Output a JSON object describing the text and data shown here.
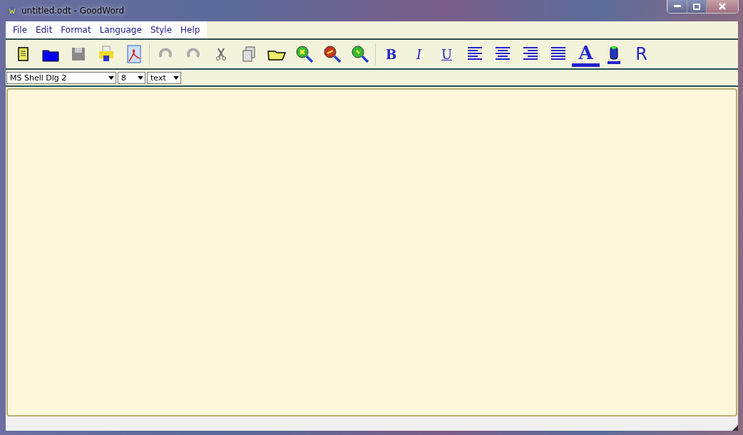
{
  "window": {
    "title": "untitled.odt - GoodWord"
  },
  "menu": [
    "File",
    "Edit",
    "Format",
    "Language",
    "Style",
    "Help"
  ],
  "toolbar": {
    "undo": {
      "disabled": true
    },
    "redo": {
      "disabled": true
    }
  },
  "format_buttons": [
    {
      "label": "B",
      "kind": "bold"
    },
    {
      "label": "I",
      "kind": "italic"
    },
    {
      "label": "U",
      "kind": "underline"
    }
  ],
  "color_buttons": [
    {
      "label": "A",
      "kind": "font"
    },
    {
      "label": "R",
      "kind": "script"
    }
  ],
  "selectors": [
    {
      "value": "MS Shell Dlg 2"
    },
    {
      "value": "8"
    },
    {
      "value": "text"
    }
  ]
}
